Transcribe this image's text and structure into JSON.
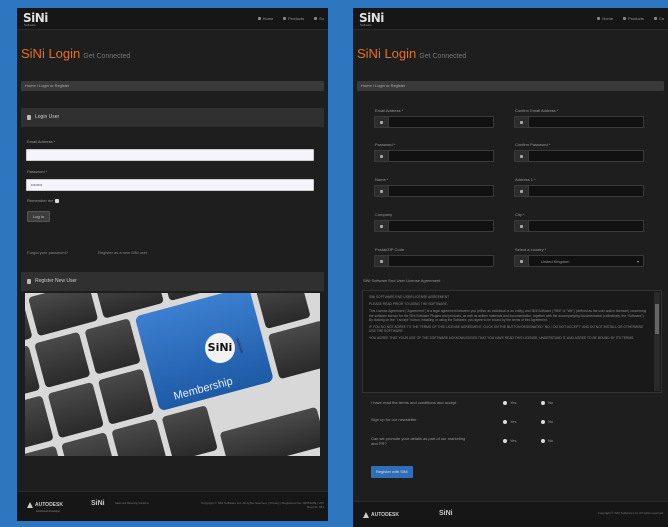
{
  "brand": {
    "logo": "SiNi",
    "logo_sub": "Software"
  },
  "nav": {
    "home": "Home",
    "products": "Products",
    "more": "Su"
  },
  "nav_right": {
    "home": "Home",
    "products": "Products",
    "more": "Ca"
  },
  "page": {
    "title": "SiNi Login",
    "subtitle": "Get Connected",
    "breadcrumb": "Home / Login or Register"
  },
  "login": {
    "heading": "Login User",
    "email_label": "Email Address *",
    "email_value": "",
    "password_label": "Password *",
    "password_value": "••••••••",
    "remember_label": "Remember me",
    "button": "Log In",
    "forgot_link": "Forgot your password?",
    "register_link": "Register as a new SiNi user"
  },
  "register": {
    "heading": "Register New User"
  },
  "promo": {
    "logo": "SiNi",
    "logo_sub": "Software",
    "text": "Membership"
  },
  "footer": {
    "autodesk": "AUTODESK",
    "autodesk_sub": "Authorised Developer",
    "sini": "SiNi",
    "sini_sub": "Sales and Marketing Solutions",
    "copyright": "Copyright © SiNi Software Ltd. All rights reserved. | Privacy | Registered No: 06557249 | VAT Reg No: 961",
    "copyright_right": "Copyright © SiNi Software Ltd. All rights reserved."
  },
  "form": {
    "email_label": "Email Address *",
    "confirm_email_label": "Confirm Email Address *",
    "password_label": "Password *",
    "confirm_password_label": "Confirm Password *",
    "name_label": "Name *",
    "address_label": "Address 1 *",
    "company_label": "Company",
    "city_label": "City *",
    "postal_label": "Postal/ZIP Code",
    "country_label": "Select a country *",
    "country_value": "United Kingdom"
  },
  "eula": {
    "heading": "SiNi Software End User License Agreement",
    "title": "SiNi SOFTWARE END USER LICENSE AGREEMENT",
    "p1": "PLEASE READ PRIOR TO USING THE SOFTWARE.",
    "p2": "This License Agreement (\"Agreement\") is a legal agreement between you (either an individual or an entity) and SiNi Software (\"SiNi\" or \"We\") (defined as the user and/or licensee) concerning the software licence for the SiNi Software Plugins and products, as well as written materials and documentation, together with the accompanying documentation (collectively, the \"Software\"). By clicking on the \"I accept\" button, installing or using the Software, you agree to be bound by the terms of this Agreement.",
    "p3": "IF YOU DO NOT AGREE TO THE TERMS OF THIS LICENSE AGREEMENT, CLICK ON THE BUTTON DESIGNATED \"NO, I DO NOT ACCEPT\" AND DO NOT INSTALL OR OTHERWISE USE THE SOFTWARE.",
    "p4": "YOU AGREE THAT YOUR USE OF THE SOFTWARE ACKNOWLEDGES THAT YOU HAVE READ THIS LICENSE, UNDERSTAND IT, AND AGREE TO BE BOUND BY ITS TERMS."
  },
  "questions": {
    "q1": "I have read the terms and conditions and accept",
    "q2": "Sign up for our newsletter",
    "q3": "Can we promote your details as part of our marketing and PR?",
    "yes": "Yes",
    "no": "No"
  },
  "register_button": "Register with SiNi",
  "colors": {
    "background": "#2f76c0",
    "accent": "#e2731f",
    "register_button": "#2e6fb8"
  }
}
